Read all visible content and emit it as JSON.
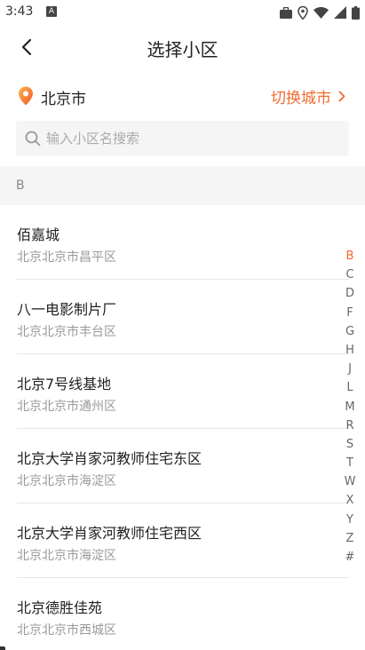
{
  "status_bar": {
    "time": "3:43",
    "notification_letter": "A",
    "icons": [
      "briefcase-icon",
      "location-icon",
      "wifi-icon",
      "signal-icon",
      "battery-icon"
    ]
  },
  "header": {
    "title": "选择小区",
    "back_icon": "chevron-left-icon"
  },
  "city": {
    "name": "北京市",
    "switch_label": "切换城市",
    "accent_color": "#ef6b2f",
    "pin_icon": "map-pin-icon"
  },
  "search": {
    "value": "",
    "placeholder": "输入小区名搜索"
  },
  "section": {
    "letter": "B"
  },
  "communities": [
    {
      "name": "佰嘉城",
      "address": "北京北京市昌平区"
    },
    {
      "name": "八一电影制片厂",
      "address": "北京北京市丰台区"
    },
    {
      "name": "北京7号线基地",
      "address": "北京北京市通州区"
    },
    {
      "name": "北京大学肖家河教师住宅东区",
      "address": "北京北京市海淀区"
    },
    {
      "name": "北京大学肖家河教师住宅西区",
      "address": "北京北京市海淀区"
    },
    {
      "name": "北京德胜佳苑",
      "address": "北京北京市西城区"
    }
  ],
  "index_bar": {
    "active": "B",
    "letters": [
      "B",
      "C",
      "D",
      "F",
      "G",
      "H",
      "J",
      "L",
      "M",
      "R",
      "S",
      "T",
      "W",
      "X",
      "Y",
      "Z",
      "#"
    ]
  }
}
